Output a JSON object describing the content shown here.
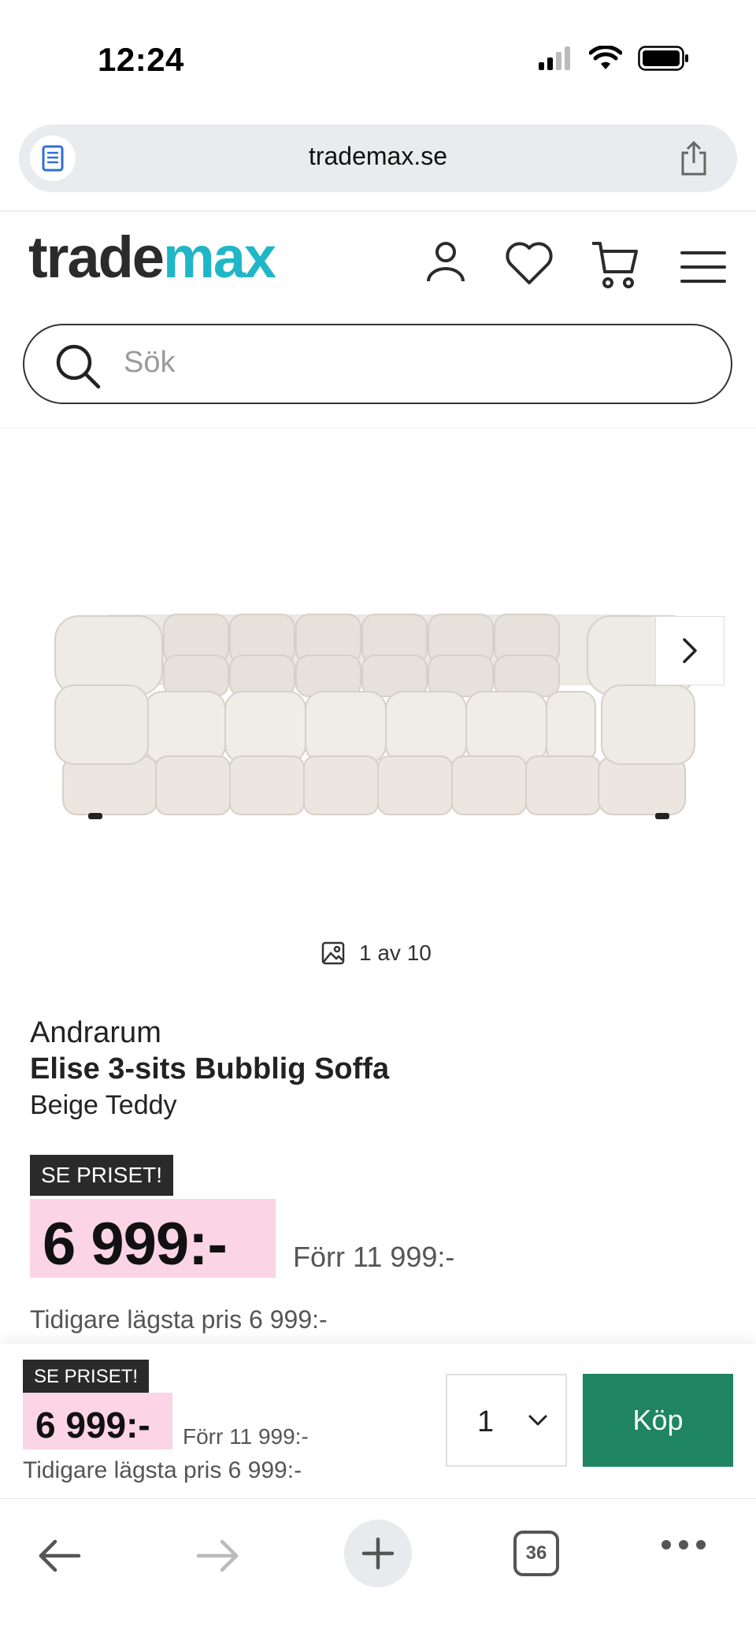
{
  "status_bar": {
    "time": "12:24"
  },
  "browser": {
    "url": "trademax.se",
    "tab_count": "36"
  },
  "header": {
    "logo_part1": "trade",
    "logo_part2": "max",
    "logo_accent_color": "#1fb6c8",
    "icons": [
      "account-icon",
      "heart-icon",
      "cart-icon",
      "menu-icon"
    ]
  },
  "search": {
    "placeholder": "Sök"
  },
  "gallery": {
    "counter": "1 av 10"
  },
  "product": {
    "brand": "Andrarum",
    "name": "Elise 3-sits Bubblig Soffa",
    "variant": "Beige Teddy",
    "badge": "SE PRISET!",
    "price": "6 999:-",
    "old_price": "Förr 11 999:-",
    "lowest_price": "Tidigare lägsta pris 6 999:-",
    "price_highlight_color": "#fbd4e5"
  },
  "buy_bar": {
    "badge": "SE PRISET!",
    "price": "6 999:-",
    "old_price": "Förr 11 999:-",
    "lowest_price": "Tidigare lägsta pris 6 999:-",
    "quantity": "1",
    "buy_label": "Köp",
    "buy_color": "#1e8462"
  }
}
